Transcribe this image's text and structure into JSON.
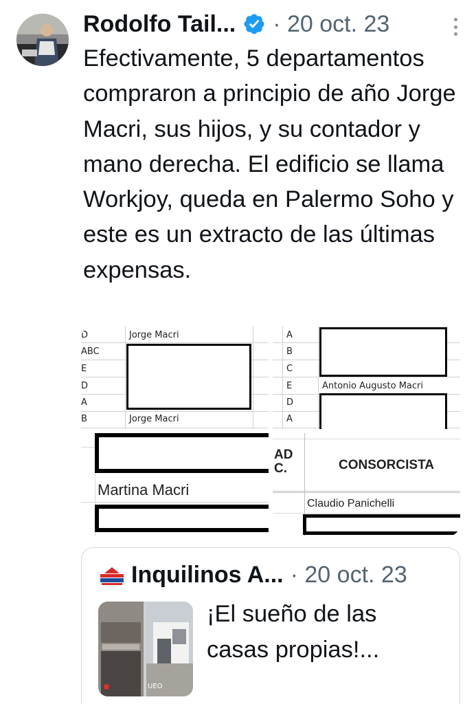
{
  "tweet": {
    "author_name": "Rodolfo Tail...",
    "meta": "· 20 oct. 23",
    "text": "Efectivamente, 5 departamentos compraron a principio de año Jorge Macri, sus hijos, y su contador y mano derecha. El edificio se llama Workjoy, queda en Palermo Soho y este es un extracto de las últimas expensas."
  },
  "media": {
    "image1": {
      "codes": [
        "D",
        "ABC",
        "E",
        "D",
        "A",
        "B"
      ],
      "name_top": "Jorge Macri",
      "name_bottom": "Jorge Macri"
    },
    "image2": {
      "codes": [
        "A",
        "B",
        "C",
        "E",
        "D",
        "A"
      ],
      "name": "Antonio Augusto Macri"
    },
    "image3": {
      "name": "Martina Macri"
    },
    "image4": {
      "col_left": "AD\nC.",
      "header": "CONSORCISTA",
      "name": "Claudio Panichelli"
    }
  },
  "quote": {
    "author_name": "Inquilinos A...",
    "meta": "· 20 oct. 23",
    "text": "¡El sueño de las casas propias!...",
    "thumb_caption": "UEO"
  },
  "colors": {
    "text": "#0f1419",
    "secondary": "#536471",
    "verified": "#1d9bf0",
    "border": "#cfd9de"
  }
}
